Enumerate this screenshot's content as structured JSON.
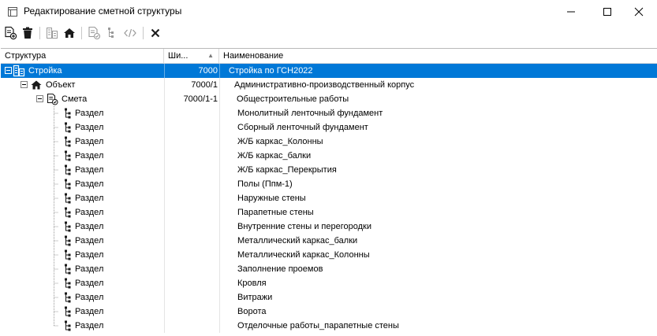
{
  "window": {
    "title": "Редактирование сметной структуры",
    "minimize_icon": "minimize-icon",
    "maximize_icon": "maximize-icon",
    "close_icon": "close-icon"
  },
  "toolbar": {
    "buttons": [
      {
        "icon": "add-document-icon",
        "enabled": true
      },
      {
        "icon": "trash-icon",
        "enabled": true
      },
      {
        "icon": "building-icon",
        "enabled": false
      },
      {
        "icon": "house-icon",
        "enabled": true
      },
      {
        "icon": "document-check-icon",
        "enabled": false
      },
      {
        "icon": "tree-node-icon",
        "enabled": false
      },
      {
        "icon": "code-tags-icon",
        "enabled": false
      },
      {
        "icon": "close-x-icon",
        "enabled": true
      }
    ]
  },
  "grid": {
    "columns": {
      "structure": "Структура",
      "code": "Ши...",
      "name": "Наименование"
    },
    "sort_indicator": "▲",
    "selected_row": 0,
    "rows": [
      {
        "level": 0,
        "type": "Стройка",
        "code": "7000",
        "name": "Стройка по ГСН2022",
        "icon": "building-icon",
        "expanded": true
      },
      {
        "level": 1,
        "type": "Объект",
        "code": "7000/1",
        "name": "Административно-производственный корпус",
        "icon": "house-icon",
        "expanded": true
      },
      {
        "level": 2,
        "type": "Смета",
        "code": "7000/1-1",
        "name": "Общестроительные работы",
        "icon": "estimate-document-icon",
        "expanded": true
      },
      {
        "level": 3,
        "type": "Раздел",
        "code": "",
        "name": "Монолитный ленточный фундамент",
        "icon": "section-tree-icon"
      },
      {
        "level": 3,
        "type": "Раздел",
        "code": "",
        "name": "Сборный ленточный фундамент",
        "icon": "section-tree-icon"
      },
      {
        "level": 3,
        "type": "Раздел",
        "code": "",
        "name": "Ж/Б каркас_Колонны",
        "icon": "section-tree-icon"
      },
      {
        "level": 3,
        "type": "Раздел",
        "code": "",
        "name": "Ж/Б каркас_балки",
        "icon": "section-tree-icon"
      },
      {
        "level": 3,
        "type": "Раздел",
        "code": "",
        "name": "Ж/Б каркас_Перекрытия",
        "icon": "section-tree-icon"
      },
      {
        "level": 3,
        "type": "Раздел",
        "code": "",
        "name": "Полы (Ппм-1)",
        "icon": "section-tree-icon"
      },
      {
        "level": 3,
        "type": "Раздел",
        "code": "",
        "name": "Наружные стены",
        "icon": "section-tree-icon"
      },
      {
        "level": 3,
        "type": "Раздел",
        "code": "",
        "name": "Парапетные стены",
        "icon": "section-tree-icon"
      },
      {
        "level": 3,
        "type": "Раздел",
        "code": "",
        "name": "Внутренние стены и перегородки",
        "icon": "section-tree-icon"
      },
      {
        "level": 3,
        "type": "Раздел",
        "code": "",
        "name": "Металлический каркас_балки",
        "icon": "section-tree-icon"
      },
      {
        "level": 3,
        "type": "Раздел",
        "code": "",
        "name": "Металлический каркас_Колонны",
        "icon": "section-tree-icon"
      },
      {
        "level": 3,
        "type": "Раздел",
        "code": "",
        "name": "Заполнение проемов",
        "icon": "section-tree-icon"
      },
      {
        "level": 3,
        "type": "Раздел",
        "code": "",
        "name": "Кровля",
        "icon": "section-tree-icon"
      },
      {
        "level": 3,
        "type": "Раздел",
        "code": "",
        "name": "Витражи",
        "icon": "section-tree-icon"
      },
      {
        "level": 3,
        "type": "Раздел",
        "code": "",
        "name": "Ворота",
        "icon": "section-tree-icon"
      },
      {
        "level": 3,
        "type": "Раздел",
        "code": "",
        "name": "Отделочные работы_парапетные стены",
        "icon": "section-tree-icon"
      }
    ]
  },
  "colors": {
    "selection": "#0078d7",
    "icon_dark": "#1a1a1a",
    "disabled_icon": "#9a9a9a"
  }
}
